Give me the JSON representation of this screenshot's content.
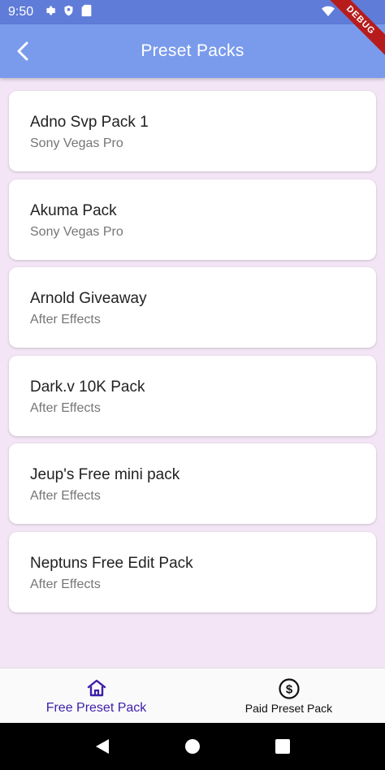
{
  "status_bar": {
    "time": "9:50"
  },
  "app_bar": {
    "title": "Preset Packs"
  },
  "debug_banner": "DEBUG",
  "packs": [
    {
      "title": "Adno Svp Pack 1",
      "subtitle": "Sony Vegas Pro"
    },
    {
      "title": "Akuma Pack",
      "subtitle": "Sony Vegas Pro"
    },
    {
      "title": "Arnold Giveaway",
      "subtitle": "After Effects"
    },
    {
      "title": "Dark.v 10K Pack",
      "subtitle": "After Effects"
    },
    {
      "title": "Jeup's Free mini pack",
      "subtitle": "After Effects"
    },
    {
      "title": "Neptuns Free Edit Pack",
      "subtitle": "After Effects"
    }
  ],
  "bottom_nav": {
    "items": [
      {
        "label": "Free Preset Pack",
        "icon": "home-icon",
        "active": true
      },
      {
        "label": "Paid Preset Pack",
        "icon": "dollar-icon",
        "active": false
      }
    ]
  },
  "colors": {
    "app_bar": "#7a9bec",
    "status_bar": "#5f7cd9",
    "background": "#f3e5f5",
    "active_nav": "#3d1ea8"
  }
}
